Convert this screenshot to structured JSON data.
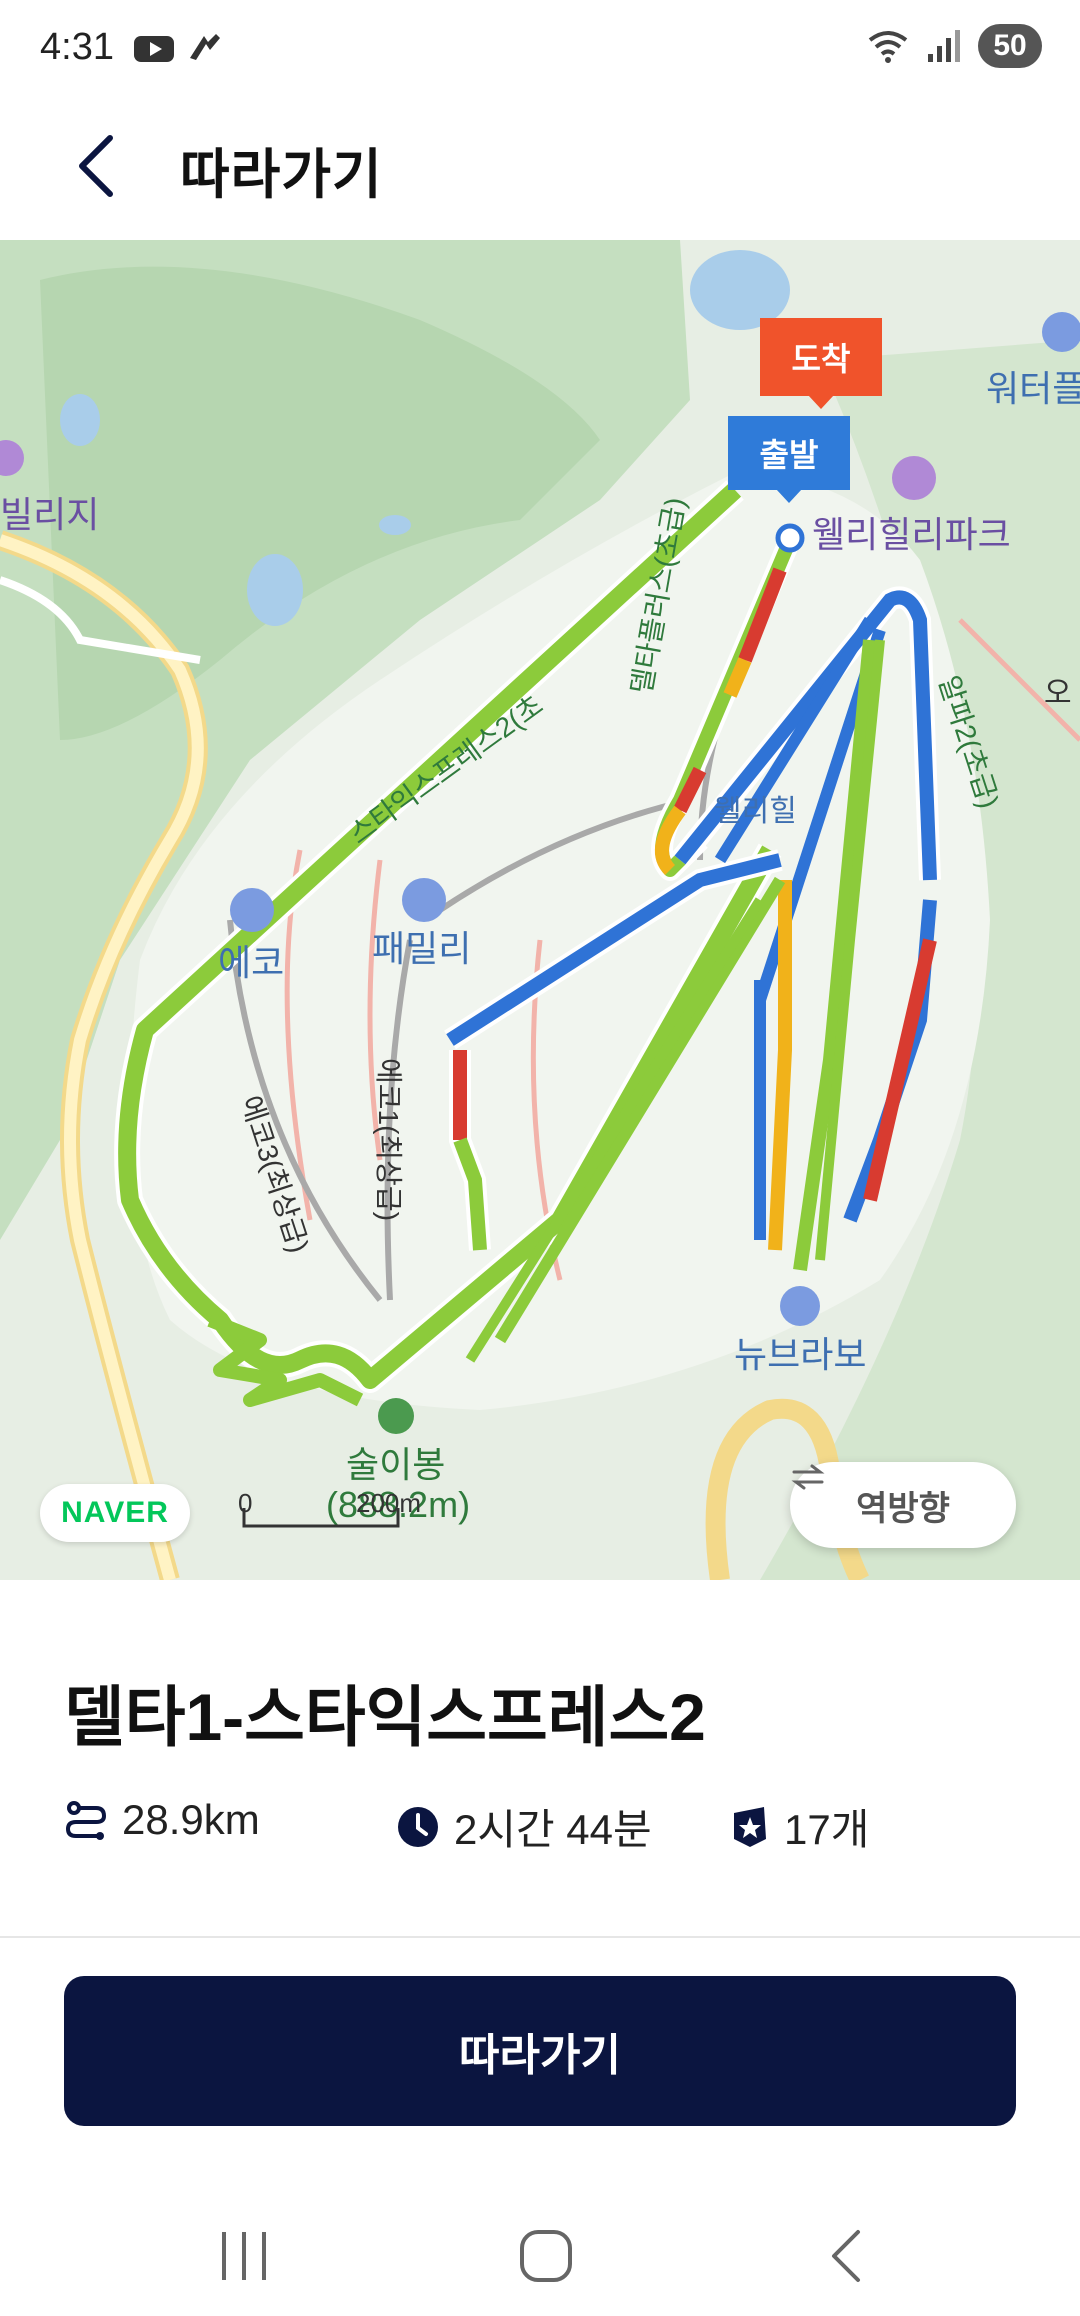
{
  "status_bar": {
    "time": "4:31",
    "battery": "50",
    "icons": [
      "youtube-icon",
      "app-icon",
      "wifi-icon",
      "signal-icon"
    ]
  },
  "header": {
    "title": "따라가기",
    "back_icon": "chevron-left-icon"
  },
  "map": {
    "labels": {
      "water_play": "워터플",
      "village": "빌리지",
      "park": "웰리힐리파크",
      "delta_plus": "델타플러스(초급)",
      "alpha2": "알파2(초급)",
      "o": "오",
      "styx_express": "스타익스프레스2(초",
      "echo": "에코",
      "family": "패밀리",
      "echo3": "에코3(최상급)",
      "echo1": "에코1(최상급)",
      "new_bravo": "뉴브라보",
      "sulibong": "술이봉",
      "elevation": "(888.2m)",
      "wellhilli_small": "웰리힐"
    },
    "markers": {
      "arrival": "도착",
      "start": "출발"
    },
    "naver_logo": "NAVER",
    "scale": {
      "zero": "0",
      "distance": "200m"
    },
    "reverse_button": "역방향",
    "colors": {
      "beginner": "#8ccb3b",
      "intermediate": "#2f73d6",
      "advanced": "#d83b30",
      "lift": "#f1b21a"
    }
  },
  "route": {
    "title": "델타1-스타익스프레스2",
    "distance": "28.9km",
    "duration": "2시간 44분",
    "checkpoints": "17개"
  },
  "follow_button": "따라가기",
  "nav_bar": {
    "icons": [
      "recent-apps-icon",
      "home-icon",
      "back-icon"
    ]
  }
}
